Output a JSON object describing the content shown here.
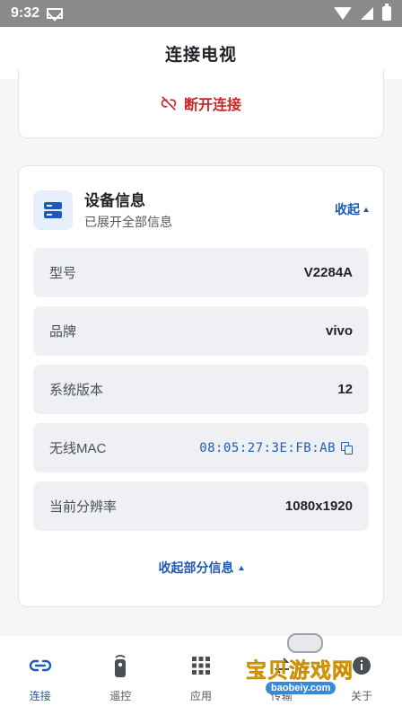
{
  "status_bar": {
    "time": "9:32"
  },
  "app_bar": {
    "title": "连接电视"
  },
  "disconnect": {
    "label": "断开连接"
  },
  "device_info": {
    "title": "设备信息",
    "subtitle": "已展开全部信息",
    "collapse_label": "收起",
    "rows": [
      {
        "label": "型号",
        "value": "V2284A"
      },
      {
        "label": "品牌",
        "value": "vivo"
      },
      {
        "label": "系统版本",
        "value": "12"
      },
      {
        "label": "无线MAC",
        "value": "08:05:27:3E:FB:AB"
      },
      {
        "label": "当前分辨率",
        "value": "1080x1920"
      }
    ],
    "collapse_partial_label": "收起部分信息"
  },
  "bottom_nav": {
    "items": [
      {
        "label": "连接",
        "icon": "link-icon",
        "active": true
      },
      {
        "label": "遥控",
        "icon": "remote-icon",
        "active": false
      },
      {
        "label": "应用",
        "icon": "apps-grid-icon",
        "active": false
      },
      {
        "label": "传输",
        "icon": "transfer-icon",
        "active": false
      },
      {
        "label": "关于",
        "icon": "about-icon",
        "active": false
      }
    ]
  },
  "watermark": {
    "title": "宝贝游戏网",
    "url": "baobeiy.com"
  },
  "colors": {
    "accent": "#1e5bb8",
    "danger": "#c62828",
    "row_bg": "#eef0f4"
  }
}
